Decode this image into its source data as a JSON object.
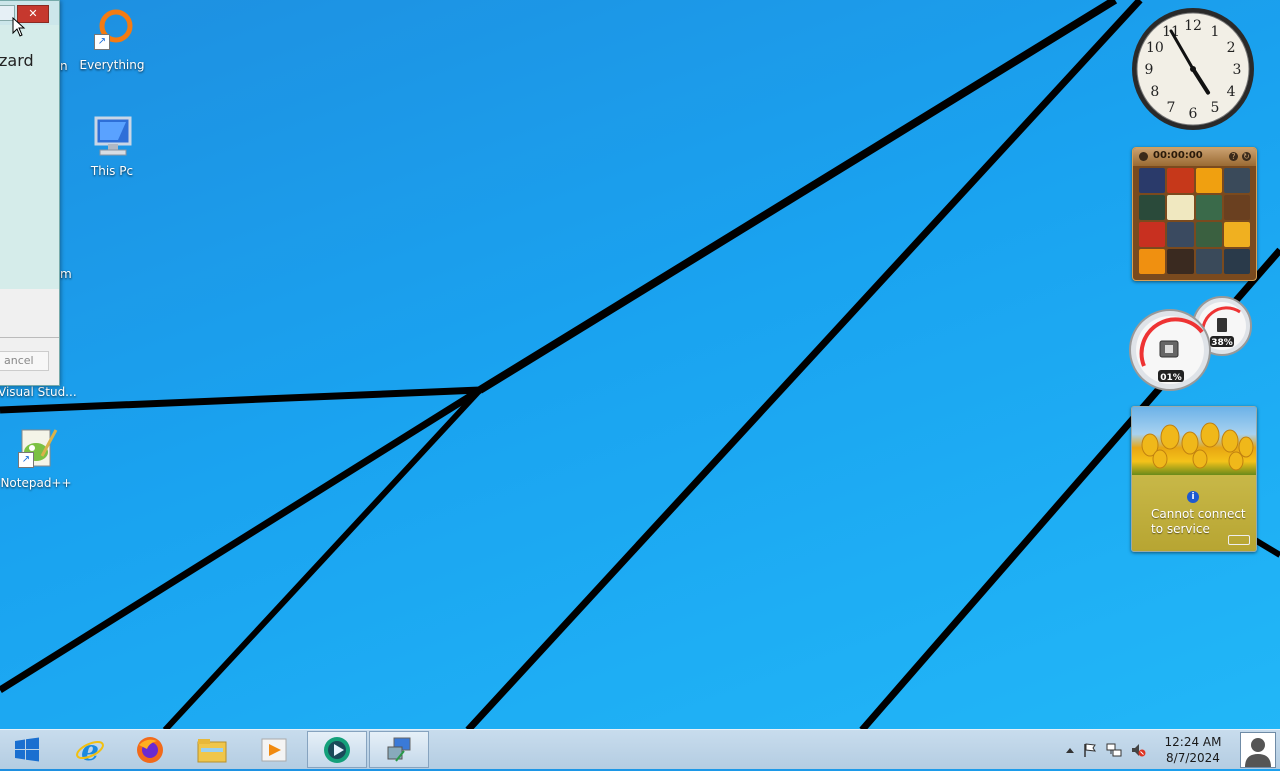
{
  "desktop": {
    "icons": [
      {
        "label": "Everything"
      },
      {
        "label": "This Pc"
      },
      {
        "label": "Visual Stud..."
      },
      {
        "label": "Notepad++"
      }
    ],
    "partial_labels": [
      "n",
      "m"
    ]
  },
  "window": {
    "title_fragment": "zard",
    "cancel_fragment": "ancel",
    "close_glyph": "✕"
  },
  "gadgets": {
    "clock": {
      "hour": 4,
      "minute": 55,
      "numbers": [
        "12",
        "1",
        "2",
        "3",
        "4",
        "5",
        "6",
        "7",
        "8",
        "9",
        "10",
        "11"
      ]
    },
    "puzzle": {
      "timer": "00:00:00",
      "tile_colors": [
        "#2a3a6a",
        "#c6381a",
        "#f0a010",
        "#3a4a5a",
        "#2a4a3a",
        "#f0e8c0",
        "#3a6a4a",
        "#6a4020",
        "#c83020",
        "#3a4a60",
        "#3a6040",
        "#f0b020",
        "#f09010",
        "#3a2a20",
        "#3a4a5a",
        "#2a3a4a"
      ]
    },
    "meter": {
      "cpu_label": "01%",
      "memory_label": "38%",
      "cpu_value": 0.01,
      "memory_value": 0.38
    },
    "weather": {
      "message": "Cannot connect to service",
      "info_glyph": "i"
    }
  },
  "taskbar": {
    "pinned": [
      "start-button",
      "internet-explorer",
      "firefox",
      "file-explorer",
      "media-player",
      "active-app",
      "active-window"
    ],
    "clock_time": "12:24 AM",
    "clock_date": "8/7/2024"
  },
  "colors": {
    "wallpaper_top": "#1e8fe0",
    "wallpaper_bottom": "#22b8f8",
    "taskbar": "#c8dced"
  }
}
